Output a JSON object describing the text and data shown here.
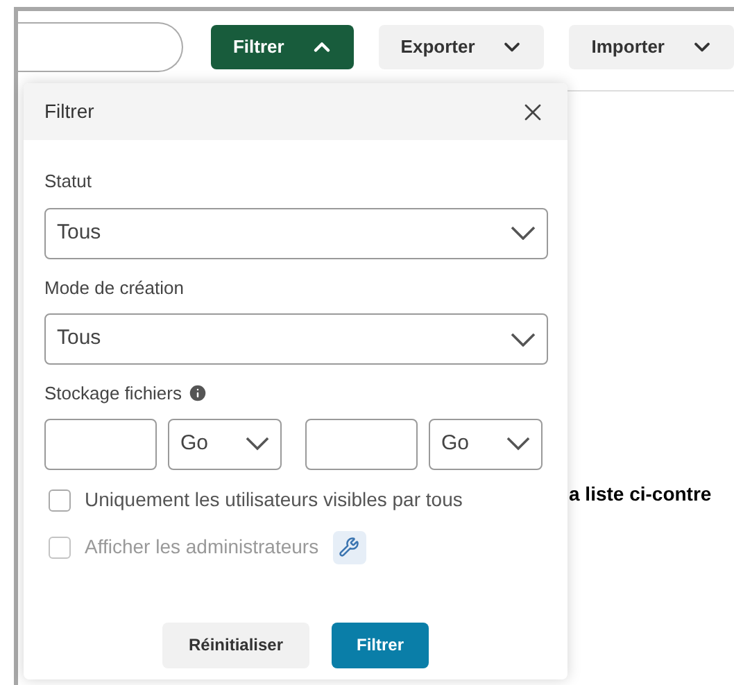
{
  "toolbar": {
    "buttons": [
      {
        "label": "Filtrer",
        "expanded": true,
        "selected": true
      },
      {
        "label": "Exporter",
        "expanded": false,
        "selected": false
      },
      {
        "label": "Importer",
        "expanded": false,
        "selected": false
      }
    ]
  },
  "background_text": "a liste ci-contre",
  "filter_panel": {
    "title": "Filtrer",
    "selects": [
      {
        "label": "Statut",
        "value": "Tous"
      },
      {
        "label": "Mode de création",
        "value": "Tous"
      }
    ],
    "storage": {
      "label": "Stockage fichiers",
      "units": [
        "Go",
        "Go"
      ]
    },
    "checkboxes": [
      {
        "label": "Uniquement les utilisateurs visibles par tous",
        "checked": false,
        "disabled": false,
        "admin_icon": false
      },
      {
        "label": "Afficher les administrateurs",
        "checked": false,
        "disabled": true,
        "admin_icon": true
      }
    ],
    "buttons": [
      {
        "label": "Réinitialiser",
        "kind": "secondary"
      },
      {
        "label": "Filtrer",
        "kind": "primary"
      }
    ]
  }
}
